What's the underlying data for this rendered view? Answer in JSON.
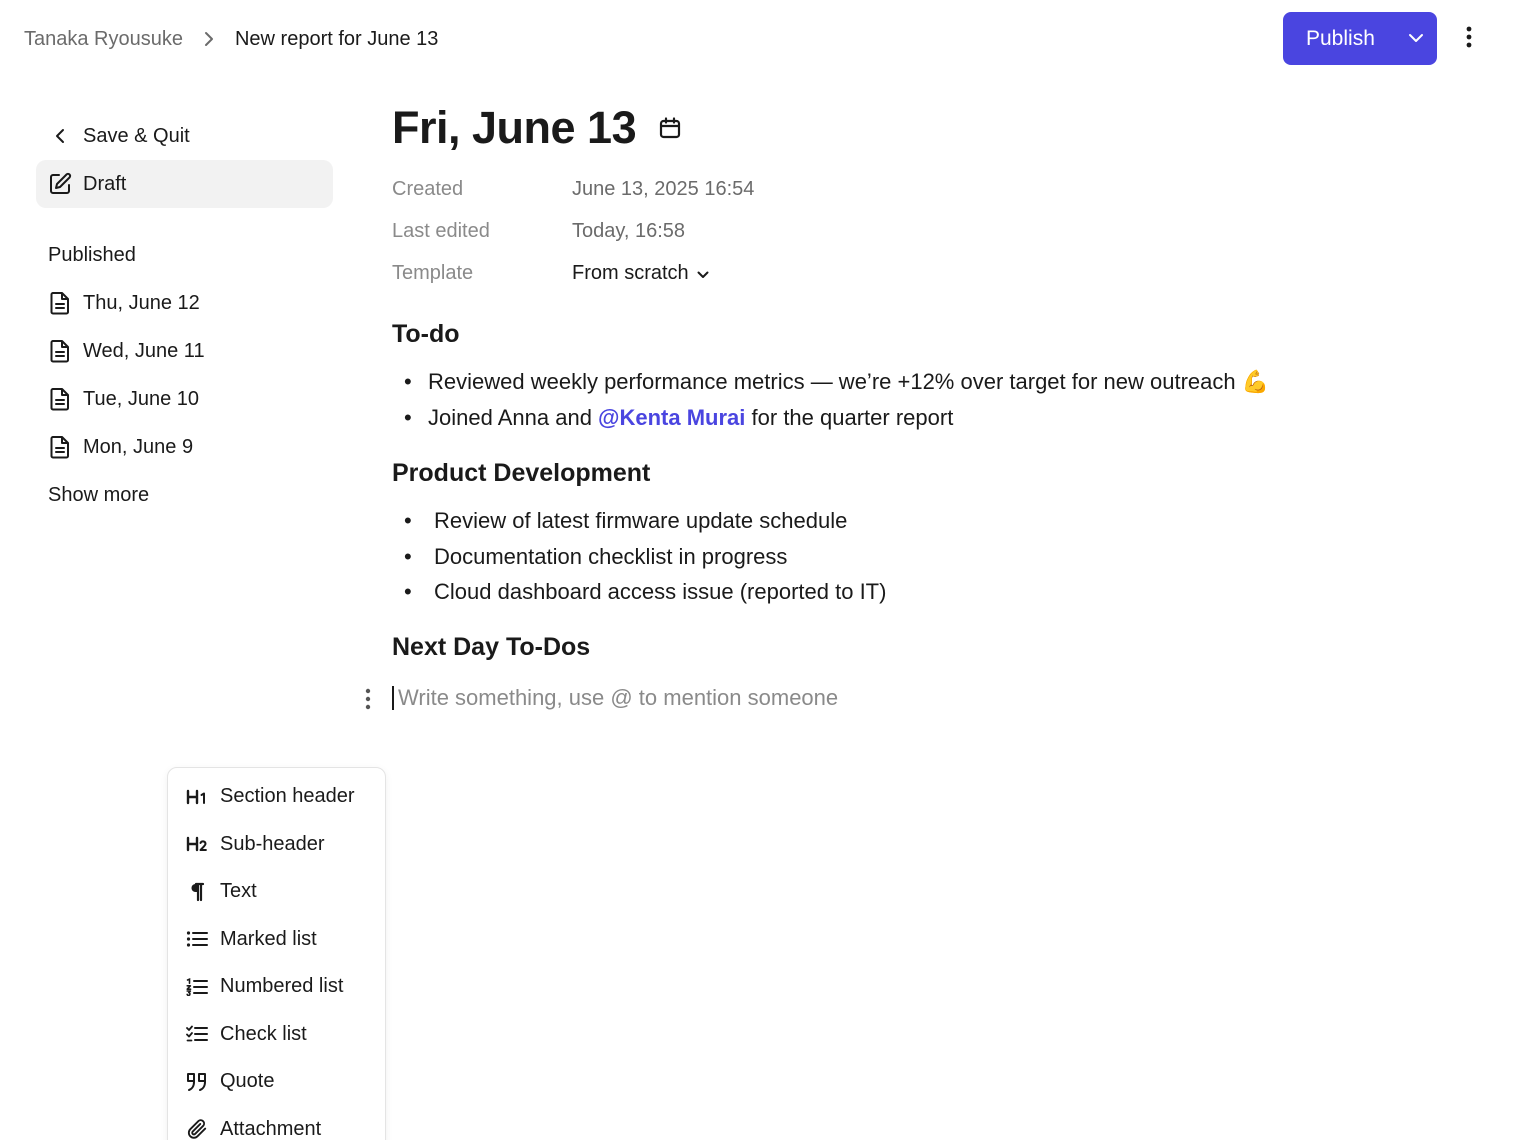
{
  "breadcrumb": {
    "parent": "Tanaka Ryousuke",
    "current": "New report for June 13"
  },
  "header": {
    "publish_label": "Publish"
  },
  "sidebar": {
    "save_quit_label": "Save & Quit",
    "draft_label": "Draft",
    "published_heading": "Published",
    "published_items": [
      "Thu, June 12",
      "Wed, June 11",
      "Tue, June 10",
      "Mon, June 9"
    ],
    "show_more_label": "Show more"
  },
  "document": {
    "title": "Fri, June 13",
    "meta": {
      "created_label": "Created",
      "created_value": "June 13, 2025 16:54",
      "last_edited_label": "Last edited",
      "last_edited_value": "Today, 16:58",
      "template_label": "Template",
      "template_value": "From scratch"
    },
    "sections": [
      {
        "heading": "To-do",
        "items": [
          {
            "text": "Reviewed weekly performance metrics — we’re +12% over target for new outreach 💪"
          },
          {
            "before": "Joined Anna and ",
            "mention": "@Kenta Murai",
            "after": " for the quarter report"
          }
        ]
      },
      {
        "heading": "Product Development",
        "items": [
          {
            "text": "Review of latest firmware update schedule"
          },
          {
            "text": "Documentation checklist in progress"
          },
          {
            "text": "Cloud dashboard access issue (reported to IT)"
          }
        ]
      },
      {
        "heading": "Next Day To-Dos"
      }
    ],
    "editor_placeholder": "Write something, use @ to mention someone"
  },
  "block_menu": {
    "items": [
      {
        "label": "Section header",
        "icon": "h1-icon"
      },
      {
        "label": "Sub-header",
        "icon": "h2-icon"
      },
      {
        "label": "Text",
        "icon": "paragraph-icon"
      },
      {
        "label": "Marked list",
        "icon": "bulleted-list-icon"
      },
      {
        "label": "Numbered list",
        "icon": "numbered-list-icon"
      },
      {
        "label": "Check list",
        "icon": "check-list-icon"
      },
      {
        "label": "Quote",
        "icon": "quote-icon"
      },
      {
        "label": "Attachment",
        "icon": "paperclip-icon"
      }
    ]
  },
  "colors": {
    "accent": "#4a45e0",
    "muted_text": "#8a8a8a",
    "active_bg": "#f2f2f2"
  }
}
